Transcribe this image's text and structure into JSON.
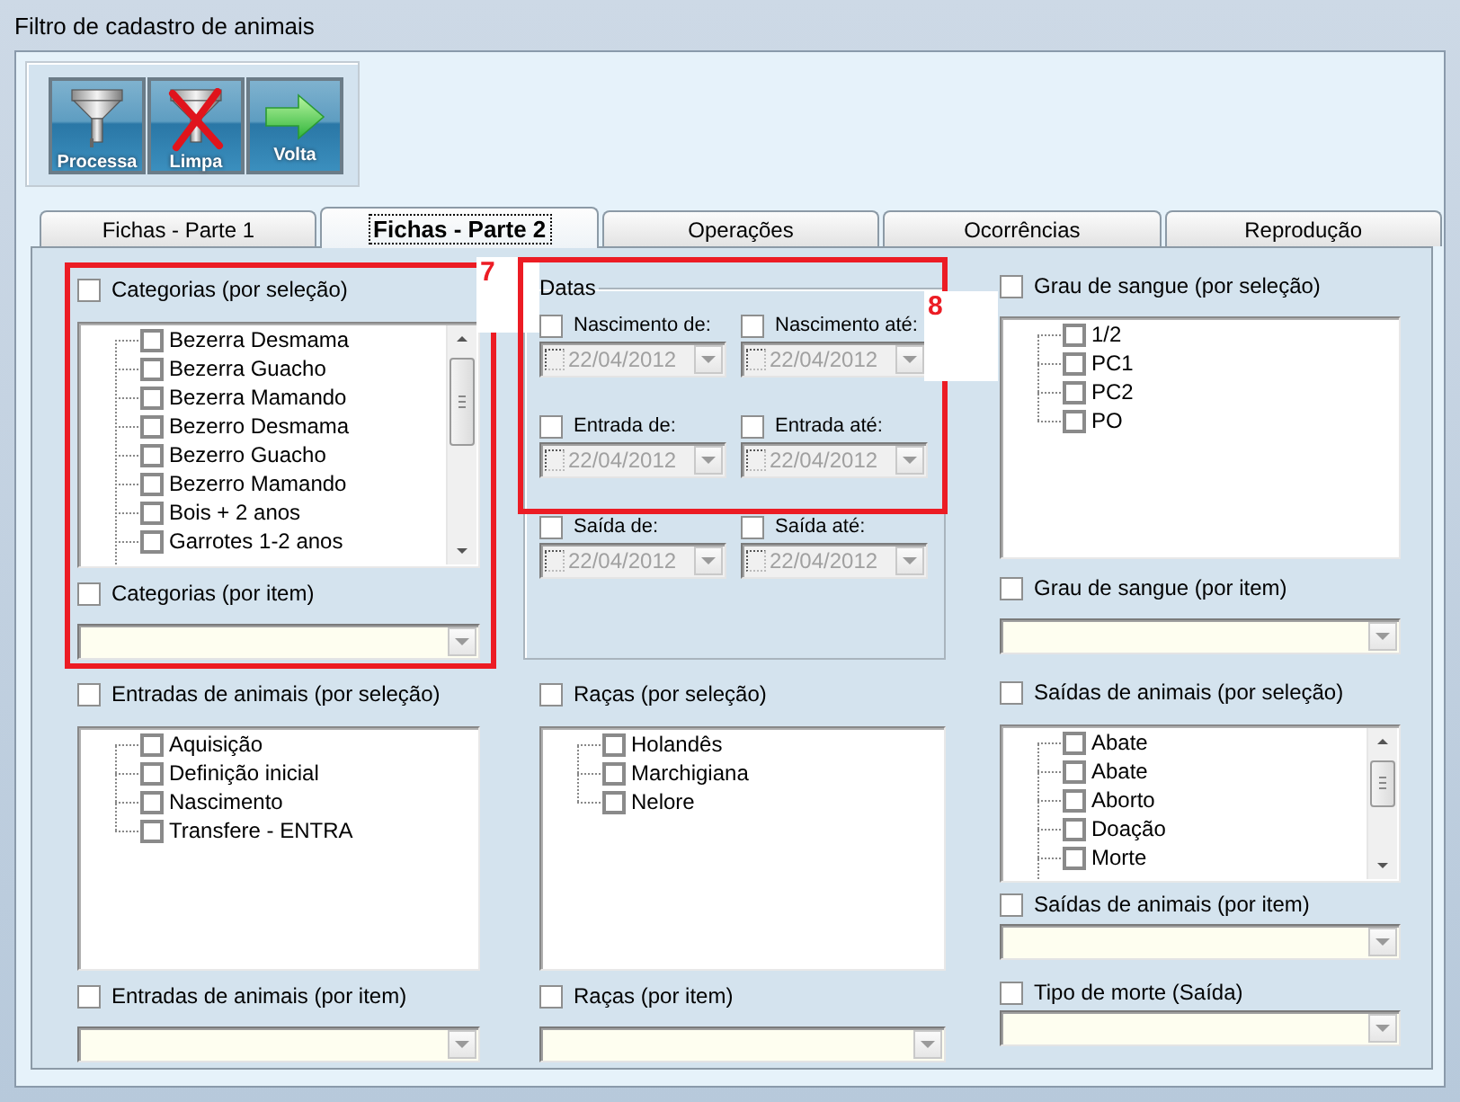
{
  "window": {
    "title": "Filtro de cadastro de animais"
  },
  "toolbar": [
    {
      "kind": "filter",
      "label": "Processa"
    },
    {
      "kind": "clear",
      "label": "Limpa"
    },
    {
      "kind": "back",
      "label": "Volta"
    }
  ],
  "tabs": [
    {
      "label": "Fichas - Parte 1",
      "selected": false
    },
    {
      "label": "Fichas - Parte 2",
      "selected": true
    },
    {
      "label": "Operações",
      "selected": false
    },
    {
      "label": "Ocorrências",
      "selected": false
    },
    {
      "label": "Reprodução",
      "selected": false
    }
  ],
  "columns": [
    {
      "sections": [
        {
          "kind": "tree",
          "label": "Categorias (por seleção)",
          "checked": false,
          "scrollbar": true,
          "items": [
            {
              "label": "Bezerra Desmama",
              "checked": false
            },
            {
              "label": "Bezerra Guacho",
              "checked": false
            },
            {
              "label": "Bezerra Mamando",
              "checked": false
            },
            {
              "label": "Bezerro Desmama",
              "checked": false
            },
            {
              "label": "Bezerro Guacho",
              "checked": false
            },
            {
              "label": "Bezerro Mamando",
              "checked": false
            },
            {
              "label": "Bois + 2 anos",
              "checked": false
            },
            {
              "label": "Garrotes 1-2 anos",
              "checked": false
            }
          ]
        },
        {
          "kind": "combo",
          "label": "Categorias (por item)",
          "checked": false
        },
        {
          "kind": "tree",
          "label": "Entradas de animais (por seleção)",
          "checked": false,
          "scrollbar": false,
          "items": [
            {
              "label": "Aquisição",
              "checked": false
            },
            {
              "label": "Definição inicial",
              "checked": false
            },
            {
              "label": "Nascimento",
              "checked": false
            },
            {
              "label": "Transfere - ENTRA",
              "checked": false
            }
          ]
        },
        {
          "kind": "combo",
          "label": "Entradas de animais (por item)",
          "checked": false
        }
      ]
    },
    {
      "sections": [
        {
          "kind": "dates",
          "title": "Datas",
          "fields": [
            {
              "label": "Nascimento de:",
              "checked": false,
              "value": "22/04/2012",
              "disabled": true
            },
            {
              "label": "Nascimento até:",
              "checked": false,
              "value": "22/04/2012",
              "disabled": true
            },
            {
              "label": "Entrada de:",
              "checked": false,
              "value": "22/04/2012",
              "disabled": true
            },
            {
              "label": "Entrada até:",
              "checked": false,
              "value": "22/04/2012",
              "disabled": true
            },
            {
              "label": "Saída de:",
              "checked": false,
              "value": "22/04/2012",
              "disabled": true
            },
            {
              "label": "Saída até:",
              "checked": false,
              "value": "22/04/2012",
              "disabled": true
            }
          ]
        },
        {
          "kind": "tree",
          "label": "Raças (por seleção)",
          "checked": false,
          "scrollbar": false,
          "items": [
            {
              "label": "Holandês",
              "checked": false
            },
            {
              "label": "Marchigiana",
              "checked": false
            },
            {
              "label": "Nelore",
              "checked": false
            }
          ]
        },
        {
          "kind": "combo",
          "label": "Raças (por item)",
          "checked": false
        }
      ]
    },
    {
      "sections": [
        {
          "kind": "tree",
          "label": "Grau de sangue (por seleção)",
          "checked": false,
          "scrollbar": false,
          "items": [
            {
              "label": "1/2",
              "checked": false
            },
            {
              "label": "PC1",
              "checked": false
            },
            {
              "label": "PC2",
              "checked": false
            },
            {
              "label": "PO",
              "checked": false
            }
          ]
        },
        {
          "kind": "combo",
          "label": "Grau de sangue (por item)",
          "checked": false
        },
        {
          "kind": "tree",
          "label": "Saídas de animais (por seleção)",
          "checked": false,
          "scrollbar": true,
          "items": [
            {
              "label": "Abate",
              "checked": false
            },
            {
              "label": "Abate",
              "checked": false
            },
            {
              "label": "Aborto",
              "checked": false
            },
            {
              "label": "Doação",
              "checked": false
            },
            {
              "label": "Morte",
              "checked": false
            }
          ]
        },
        {
          "kind": "combo",
          "label": "Saídas de animais (por item)",
          "checked": false
        },
        {
          "kind": "combo",
          "label": "Tipo de morte (Saída)",
          "checked": false
        }
      ]
    }
  ],
  "annotations": [
    {
      "label": "7"
    },
    {
      "label": "8"
    }
  ]
}
